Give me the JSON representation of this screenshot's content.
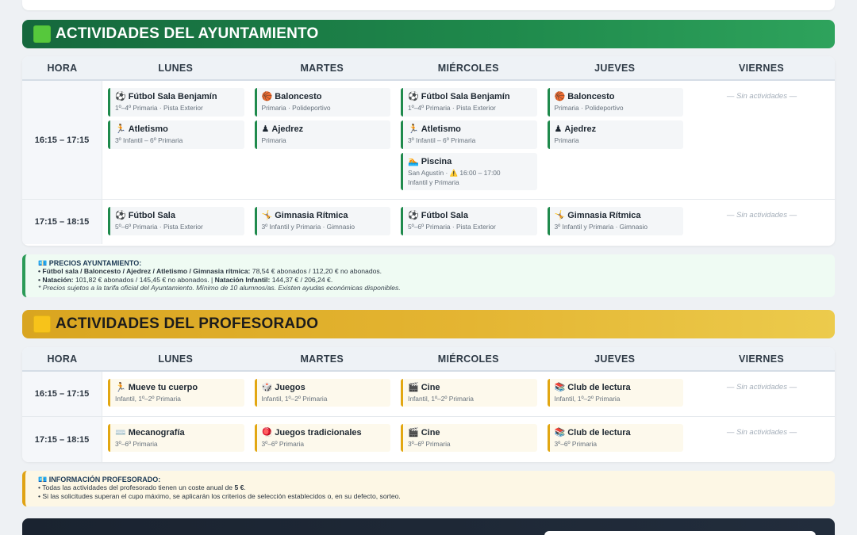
{
  "ayto": {
    "title": "ACTIVIDADES DEL AYUNTAMIENTO",
    "headers": [
      "HORA",
      "LUNES",
      "MARTES",
      "MIÉRCOLES",
      "JUEVES",
      "VIERNES"
    ],
    "rows": [
      {
        "hora": "16:15 – 17:15",
        "days": [
          [
            {
              "icon": "⚽",
              "title": "Fútbol Sala Benjamín",
              "sub": "1º–4º Primaria · Pista Exterior"
            },
            {
              "icon": "🏃",
              "title": "Atletismo",
              "sub": "3º Infantil – 6º Primaria"
            }
          ],
          [
            {
              "icon": "🏀",
              "title": "Baloncesto",
              "sub": "Primaria · Polideportivo"
            },
            {
              "icon": "♟",
              "title": "Ajedrez",
              "sub": "Primaria"
            }
          ],
          [
            {
              "icon": "⚽",
              "title": "Fútbol Sala Benjamín",
              "sub": "1º–4º Primaria · Pista Exterior"
            },
            {
              "icon": "🏃",
              "title": "Atletismo",
              "sub": "3º Infantil – 6º Primaria"
            },
            {
              "icon": "🏊",
              "title": "Piscina",
              "sub": "San Agustín · ⚠️ 16:00 – 17:00",
              "sub2": "Infantil y Primaria"
            }
          ],
          [
            {
              "icon": "🏀",
              "title": "Baloncesto",
              "sub": "Primaria · Polideportivo"
            },
            {
              "icon": "♟",
              "title": "Ajedrez",
              "sub": "Primaria"
            }
          ],
          []
        ]
      },
      {
        "hora": "17:15 – 18:15",
        "days": [
          [
            {
              "icon": "⚽",
              "title": "Fútbol Sala",
              "sub": "5º–6º Primaria · Pista Exterior"
            }
          ],
          [
            {
              "icon": "🤸",
              "title": "Gimnasia Rítmica",
              "sub": "3º Infantil y Primaria · Gimnasio"
            }
          ],
          [
            {
              "icon": "⚽",
              "title": "Fútbol Sala",
              "sub": "5º–6º Primaria · Pista Exterior"
            }
          ],
          [
            {
              "icon": "🤸",
              "title": "Gimnasia Rítmica",
              "sub": "3º Infantil y Primaria · Gimnasio"
            }
          ],
          []
        ]
      }
    ],
    "empty_label": "— Sin actividades —",
    "prices": {
      "heading": "💶 PRECIOS AYUNTAMIENTO:",
      "line1_bold": "• Fútbol sala / Baloncesto / Ajedrez / Atletismo / Gimnasia rítmica:",
      "line1_rest": " 78,54 € abonados / 112,20 € no abonados.",
      "line2_bold_a": "• Natación:",
      "line2_rest_a": " 101,82 € abonados / 145,45 € no abonados.  |  ",
      "line2_bold_b": "Natación Infantil:",
      "line2_rest_b": " 144,37 € / 206,24 €.",
      "line3": "* Precios sujetos a la tarifa oficial del Ayuntamiento. Mínimo de 10 alumnos/as. Existen ayudas económicas disponibles."
    }
  },
  "prof": {
    "title": "ACTIVIDADES DEL PROFESORADO",
    "headers": [
      "HORA",
      "LUNES",
      "MARTES",
      "MIÉRCOLES",
      "JUEVES",
      "VIERNES"
    ],
    "rows": [
      {
        "hora": "16:15 – 17:15",
        "days": [
          [
            {
              "icon": "🏃",
              "title": "Mueve tu cuerpo",
              "sub": "Infantil, 1º–2º Primaria"
            }
          ],
          [
            {
              "icon": "🎲",
              "title": "Juegos",
              "sub": "Infantil, 1º–2º Primaria"
            }
          ],
          [
            {
              "icon": "🎬",
              "title": "Cine",
              "sub": "Infantil, 1º–2º Primaria"
            }
          ],
          [
            {
              "icon": "📚",
              "title": "Club de lectura",
              "sub": "Infantil, 1º–2º Primaria"
            }
          ],
          []
        ]
      },
      {
        "hora": "17:15 – 18:15",
        "days": [
          [
            {
              "icon": "⌨️",
              "title": "Mecanografía",
              "sub": "3º–6º Primaria"
            }
          ],
          [
            {
              "icon": "🪀",
              "title": "Juegos tradicionales",
              "sub": "3º–6º Primaria"
            }
          ],
          [
            {
              "icon": "🎬",
              "title": "Cine",
              "sub": "3º–6º Primaria"
            }
          ],
          [
            {
              "icon": "📚",
              "title": "Club de lectura",
              "sub": "3º–6º Primaria"
            }
          ],
          []
        ]
      }
    ],
    "empty_label": "— Sin actividades —",
    "info": {
      "heading": "💶 INFORMACIÓN PROFESORADO:",
      "line1_a": "• Todas las actividades del profesorado tienen un coste anual de ",
      "line1_b": "5 €",
      "line1_c": ".",
      "line2": "• Si las solicitudes superan el cupo máximo, se aplicarán los criterios de selección establecidos o, en su defecto, sorteo."
    }
  },
  "colors": {
    "ayto_accent": "#1f8a4c",
    "prof_accent": "#e2a712"
  }
}
